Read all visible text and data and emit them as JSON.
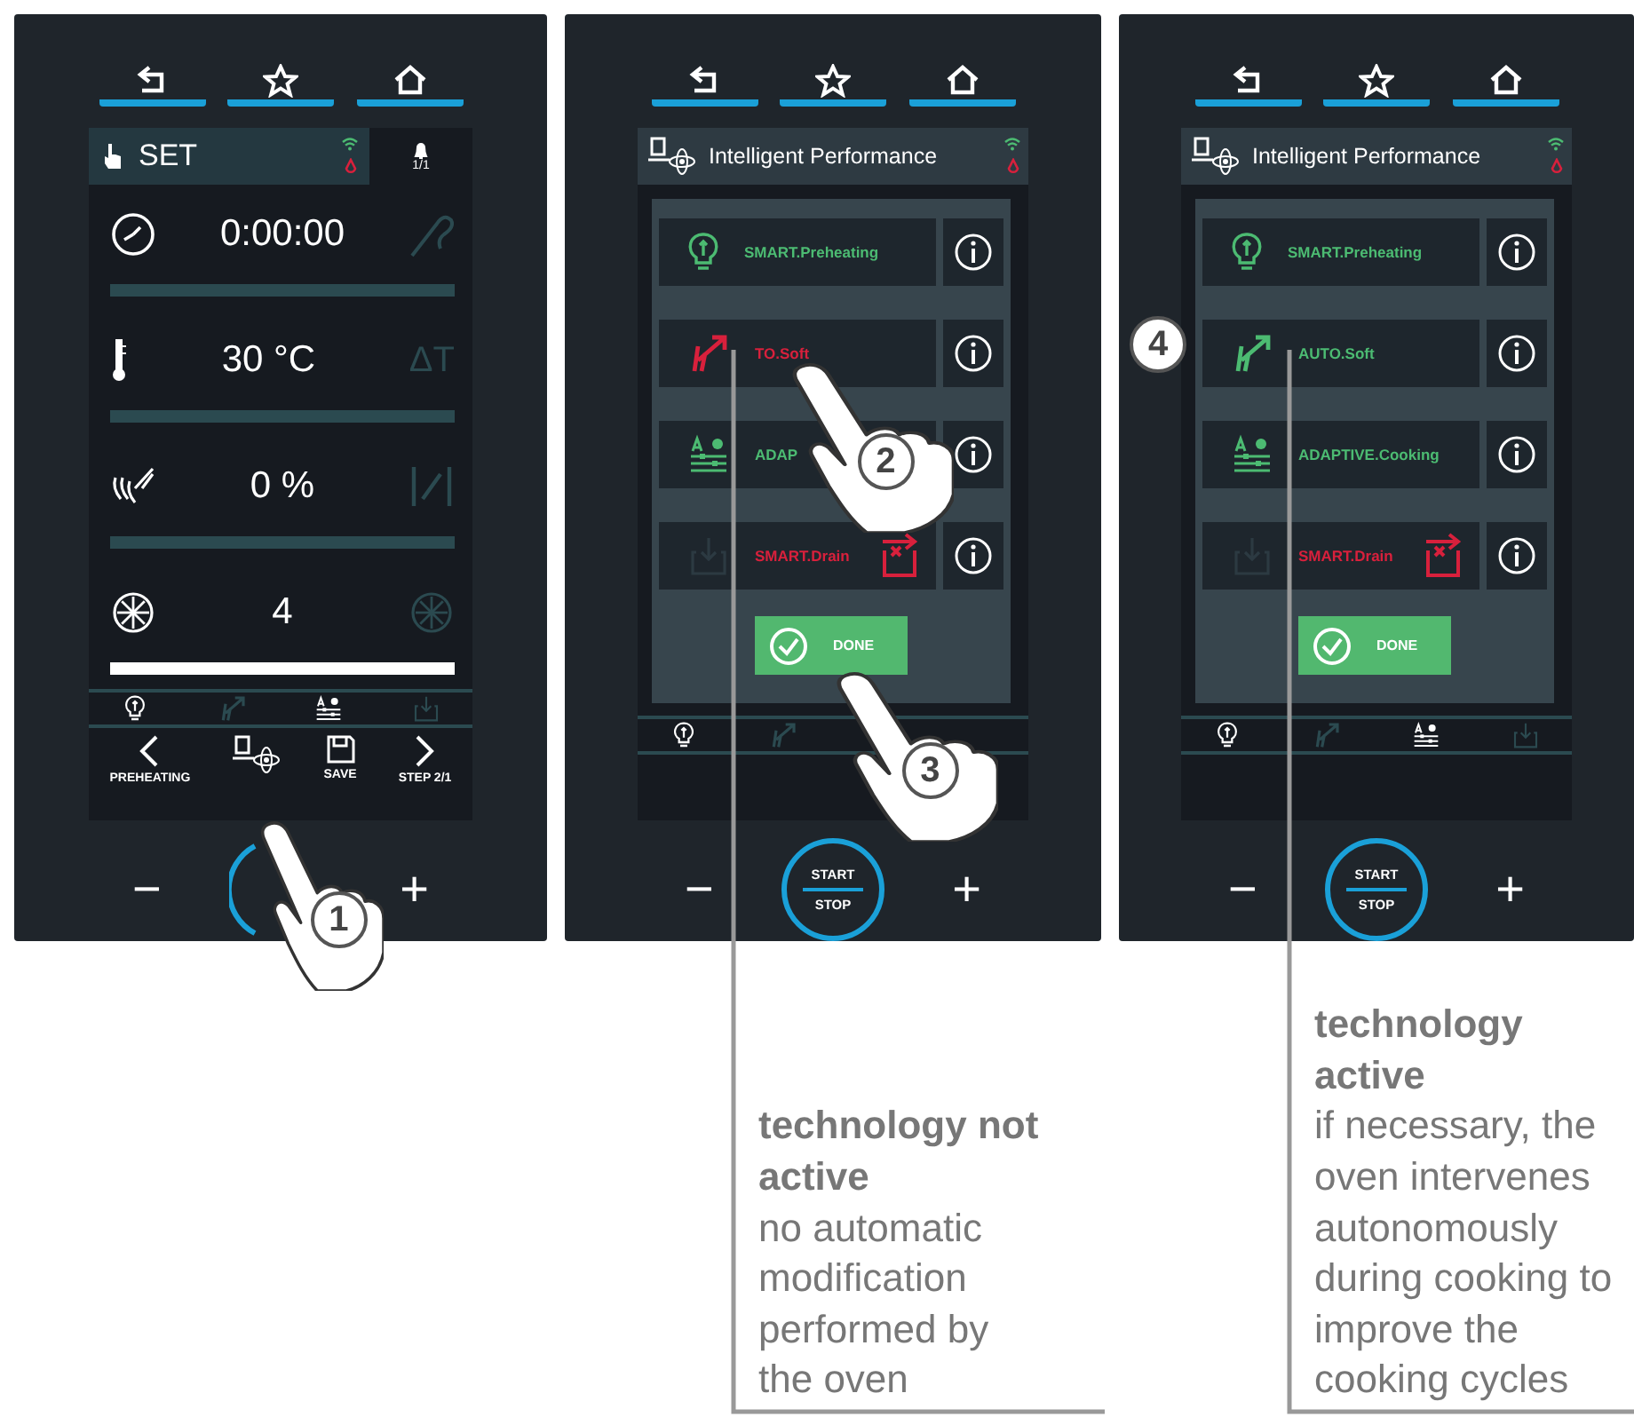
{
  "panels": [
    {
      "kind": "set",
      "header": {
        "title": "SET",
        "count": "1/1"
      },
      "rows": [
        {
          "kind": "time",
          "value": "0:00:00",
          "active": false
        },
        {
          "kind": "temp",
          "value": "30 °C",
          "right_text": "ΔT",
          "active": false
        },
        {
          "kind": "humidity",
          "value": "0 %",
          "active": false
        },
        {
          "kind": "fan",
          "value": "4",
          "active": true
        }
      ],
      "footer": [
        {
          "kind": "prev",
          "label": "PREHEATING"
        },
        {
          "kind": "ip"
        },
        {
          "kind": "save",
          "label": "SAVE"
        },
        {
          "kind": "next",
          "label": "STEP 2/1"
        }
      ],
      "minus": "−",
      "plus": "+",
      "steps": [
        "1"
      ]
    },
    {
      "kind": "ip",
      "header": {
        "title": "Intelligent Performance"
      },
      "items": [
        {
          "kind": "preheat",
          "label": "SMART.Preheating",
          "active": true
        },
        {
          "kind": "soft",
          "label": "TO.Soft",
          "active": false
        },
        {
          "kind": "adaptive",
          "label": "ADAP",
          "active": true
        },
        {
          "kind": "drain",
          "label": "SMART.Drain",
          "active": false
        }
      ],
      "done": "DONE",
      "start_stop": [
        "START",
        "STOP"
      ],
      "minus": "−",
      "plus": "+",
      "steps": [
        "2",
        "3"
      ]
    },
    {
      "kind": "ip",
      "header": {
        "title": "Intelligent Performance"
      },
      "items": [
        {
          "kind": "preheat",
          "label": "SMART.Preheating",
          "active": true
        },
        {
          "kind": "soft",
          "label": "AUTO.Soft",
          "active": true
        },
        {
          "kind": "adaptive",
          "label": "ADAPTIVE.Cooking",
          "active": true
        },
        {
          "kind": "drain",
          "label": "SMART.Drain",
          "active": false
        }
      ],
      "done": "DONE",
      "start_stop": [
        "START",
        "STOP"
      ],
      "minus": "−",
      "plus": "+",
      "marker": "4"
    }
  ],
  "callouts": [
    {
      "title": "technology not active",
      "text": "no automatic modification performed by the oven"
    },
    {
      "title": "technology active",
      "text": "if necessary, the oven intervenes autonomously during cooking to improve the cooking cycles"
    }
  ]
}
